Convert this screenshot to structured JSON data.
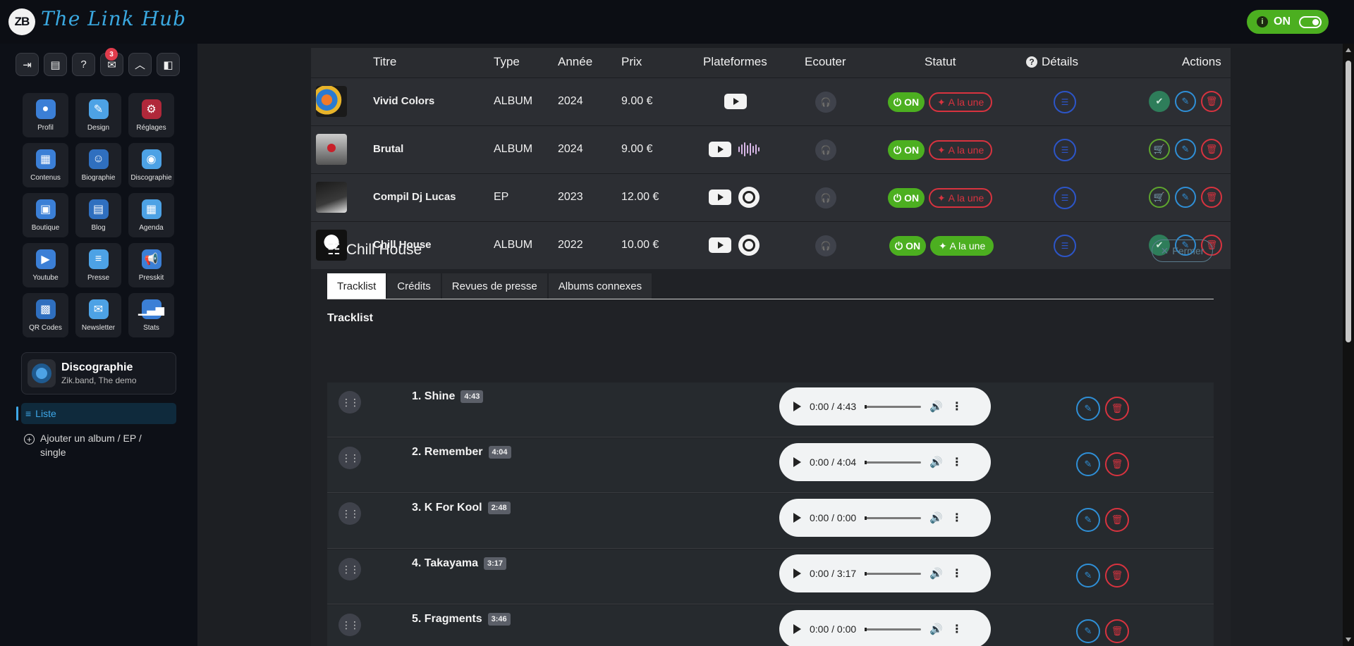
{
  "app": {
    "logo_initials": "ZB",
    "logo_text": "The Link Hub",
    "status_toggle_label": "ON"
  },
  "quick_buttons": {
    "help": "?",
    "notifications_count": "3"
  },
  "menu": [
    {
      "label": "Profil",
      "icon": "profile-icon"
    },
    {
      "label": "Design",
      "icon": "palette-icon"
    },
    {
      "label": "Réglages",
      "icon": "settings-icon"
    },
    {
      "label": "Contenus",
      "icon": "content-icon"
    },
    {
      "label": "Biographie",
      "icon": "biography-icon"
    },
    {
      "label": "Discographie",
      "icon": "disc-icon"
    },
    {
      "label": "Boutique",
      "icon": "shop-icon"
    },
    {
      "label": "Blog",
      "icon": "blog-icon"
    },
    {
      "label": "Agenda",
      "icon": "calendar-icon"
    },
    {
      "label": "Youtube",
      "icon": "video-icon"
    },
    {
      "label": "Presse",
      "icon": "press-icon"
    },
    {
      "label": "Presskit",
      "icon": "megaphone-icon"
    },
    {
      "label": "QR Codes",
      "icon": "qr-icon"
    },
    {
      "label": "Newsletter",
      "icon": "newsletter-icon"
    },
    {
      "label": "Stats",
      "icon": "stats-icon"
    }
  ],
  "section": {
    "title": "Discographie",
    "subtitle": "Zik.band, The demo"
  },
  "nav": {
    "list_label": "Liste",
    "add_label": "Ajouter un album / EP / single"
  },
  "table": {
    "headers": {
      "titre": "Titre",
      "type": "Type",
      "annee": "Année",
      "prix": "Prix",
      "plateformes": "Plateformes",
      "ecouter": "Ecouter",
      "statut": "Statut",
      "details": "Détails",
      "actions": "Actions"
    },
    "rows": [
      {
        "title": "Vivid Colors",
        "type": "ALBUM",
        "year": "2024",
        "price": "9.00 €",
        "status": "ON",
        "feature": "A la une",
        "featured": false
      },
      {
        "title": "Brutal",
        "type": "ALBUM",
        "year": "2024",
        "price": "9.00 €",
        "status": "ON",
        "feature": "A la une",
        "featured": false
      },
      {
        "title": "Compil Dj Lucas",
        "type": "EP",
        "year": "2023",
        "price": "12.00 €",
        "status": "ON",
        "feature": "A la une",
        "featured": false
      },
      {
        "title": "Chill House",
        "type": "ALBUM",
        "year": "2022",
        "price": "10.00 €",
        "status": "ON",
        "feature": "A la une",
        "featured": true
      }
    ]
  },
  "detail": {
    "title": "Chill House",
    "close_label": "Fermer",
    "tabs": [
      "Tracklist",
      "Crédits",
      "Revues de presse",
      "Albums connexes"
    ],
    "tracklist_heading": "Tracklist",
    "tracks": [
      {
        "name": "1. Shine",
        "duration": "4:43",
        "player_time": "0:00 / 4:43"
      },
      {
        "name": "2. Remember",
        "duration": "4:04",
        "player_time": "0:00 / 4:04"
      },
      {
        "name": "3. K For Kool",
        "duration": "2:48",
        "player_time": "0:00 / 0:00"
      },
      {
        "name": "4. Takayama",
        "duration": "3:17",
        "player_time": "0:00 / 3:17"
      },
      {
        "name": "5. Fragments",
        "duration": "3:46",
        "player_time": "0:00 / 0:00"
      }
    ]
  },
  "colors": {
    "accent_green": "#4caf20",
    "accent_blue": "#2f8fd6",
    "danger_red": "#d8333f"
  }
}
